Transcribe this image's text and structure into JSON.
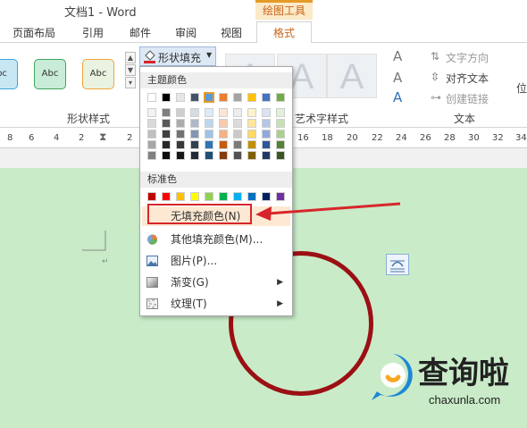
{
  "window": {
    "title": "文档1 - Word"
  },
  "contextual": {
    "group_label": "绘图工具"
  },
  "tabs": [
    "页面布局",
    "引用",
    "邮件",
    "审阅",
    "视图"
  ],
  "active_tab": "格式",
  "ribbon": {
    "shape_styles": {
      "swatch_label": "Abc",
      "swatches": [
        {
          "label": "bc",
          "bg": "#c8e7f5",
          "border": "#3ba6d9"
        },
        {
          "label": "Abc",
          "bg": "#c8ecd8",
          "border": "#40a35d"
        },
        {
          "label": "Abc",
          "bg": "#e9f3df",
          "border": "#f2a43c"
        }
      ],
      "group_label": "形状样式"
    },
    "fill_button_label": "形状填充",
    "wordart_letter": "A",
    "wordart_group_label": "艺术字样式",
    "text_group": {
      "text_direction": "文字方向",
      "align_text": "对齐文本",
      "create_link": "创建链接",
      "group_label": "文本"
    },
    "position_label": "位"
  },
  "ruler": {
    "left_numbers": [
      "8",
      "6",
      "4",
      "2",
      "2"
    ],
    "right_numbers": [
      "16",
      "18",
      "20",
      "22",
      "24",
      "26",
      "28",
      "30",
      "32",
      "34"
    ]
  },
  "fill_menu": {
    "theme_colors_label": "主题颜色",
    "theme_top_row": [
      "#ffffff",
      "#000000",
      "#e7e6e6",
      "#44546a",
      "#5b9bd5",
      "#ed7d31",
      "#a5a5a5",
      "#ffc000",
      "#4472c4",
      "#70ad47"
    ],
    "theme_shades": [
      [
        "#f2f2f2",
        "#d9d9d9",
        "#bfbfbf",
        "#a6a6a6",
        "#808080"
      ],
      [
        "#7f7f7f",
        "#595959",
        "#404040",
        "#262626",
        "#0d0d0d"
      ],
      [
        "#d0cece",
        "#aeabab",
        "#757171",
        "#3a3838",
        "#171616"
      ],
      [
        "#d6dce4",
        "#adb9ca",
        "#8496b0",
        "#323f4f",
        "#222a35"
      ],
      [
        "#deebf7",
        "#bdd7ee",
        "#9dc3e6",
        "#2e75b6",
        "#1f4e79"
      ],
      [
        "#fbe5d6",
        "#f8cbad",
        "#f4b183",
        "#c55a11",
        "#843c0c"
      ],
      [
        "#ededed",
        "#dbdbdb",
        "#c9c9c9",
        "#7b7b7b",
        "#525252"
      ],
      [
        "#fff2cc",
        "#ffe699",
        "#ffd966",
        "#bf9000",
        "#7f6000"
      ],
      [
        "#dae3f3",
        "#b4c7e7",
        "#8faadc",
        "#2f5597",
        "#203864"
      ],
      [
        "#e2f0d9",
        "#c5e0b4",
        "#a9d18e",
        "#548235",
        "#385723"
      ]
    ],
    "standard_colors_label": "标准色",
    "standard_colors": [
      "#c00000",
      "#ff0000",
      "#ffc000",
      "#ffff00",
      "#92d050",
      "#00b050",
      "#00b0f0",
      "#0070c0",
      "#002060",
      "#7030a0"
    ],
    "items": [
      {
        "label": "无填充颜色(N)",
        "has_arrow": false,
        "icon": "none"
      },
      {
        "label": "其他填充颜色(M)...",
        "has_arrow": false,
        "icon": "palette-icon"
      },
      {
        "label": "图片(P)...",
        "has_arrow": false,
        "icon": "picture-icon"
      },
      {
        "label": "渐变(G)",
        "has_arrow": true,
        "icon": "gradient-icon"
      },
      {
        "label": "纹理(T)",
        "has_arrow": true,
        "icon": "texture-icon"
      }
    ]
  },
  "colors": {
    "accent": "#c8641a",
    "highlight": "#d7262b",
    "circle": "#9b1014",
    "page": "#c9ebc8"
  },
  "watermark": {
    "cn": "查询啦",
    "en": "chaxunla.com"
  }
}
